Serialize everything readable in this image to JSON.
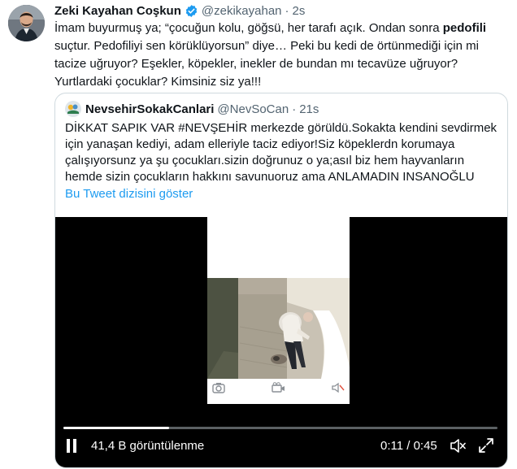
{
  "tweet": {
    "author_name": "Zeki Kayahan Coşkun",
    "handle": "@zekikayahan",
    "separator": "·",
    "time": "2s",
    "text_lines": [
      "İmam buyurmuş ya; “çocuğun kolu, göğsü, her tarafı açık. Ondan sonra ",
      "pedofili",
      "suçtur. Pedofiliyi sen körüklüyorsun” diye… Peki bu kedi de örtünmediği için mi",
      "tacize uğruyor? Eşekler, köpekler, inekler de bundan mı tecavüze uğruyor?",
      "Yurtlardaki çocuklar? Kimsiniz siz ya!!!"
    ]
  },
  "quote": {
    "author_name": "NevsehirSokakCanlari",
    "handle": "@NevSoCan",
    "separator": "·",
    "time": "21s",
    "text_lines": [
      "DİKKAT SAPIK VAR #NEVŞEHİR merkezde görüldü.Sokakta kendini sevdirmek",
      "için yanaşan kediyi, adam elleriyle taciz ediyor!Siz köpeklerdn korumaya",
      "çalışıyorsunz ya şu çocukları.sizin doğrunuz o ya;asıl biz hem hayvanların",
      "hemde sizin çocukların hakkını savunuoruz ama ANLAMADIN INSANOĞLU"
    ],
    "show_thread": "Bu Tweet dizisini göster"
  },
  "video": {
    "views": "41,4 B görüntülenme",
    "time_display": "0:11 / 0:45",
    "progress": 0.244,
    "icons": [
      "pause-icon",
      "mute-icon",
      "fullscreen-icon",
      "camera-icon",
      "video-icon",
      "volume-off-icon"
    ]
  },
  "colors": {
    "text": "#0f1419",
    "muted": "#536471",
    "link": "#1d9bf0",
    "border": "#cfd9de",
    "video_bg": "#000000"
  }
}
